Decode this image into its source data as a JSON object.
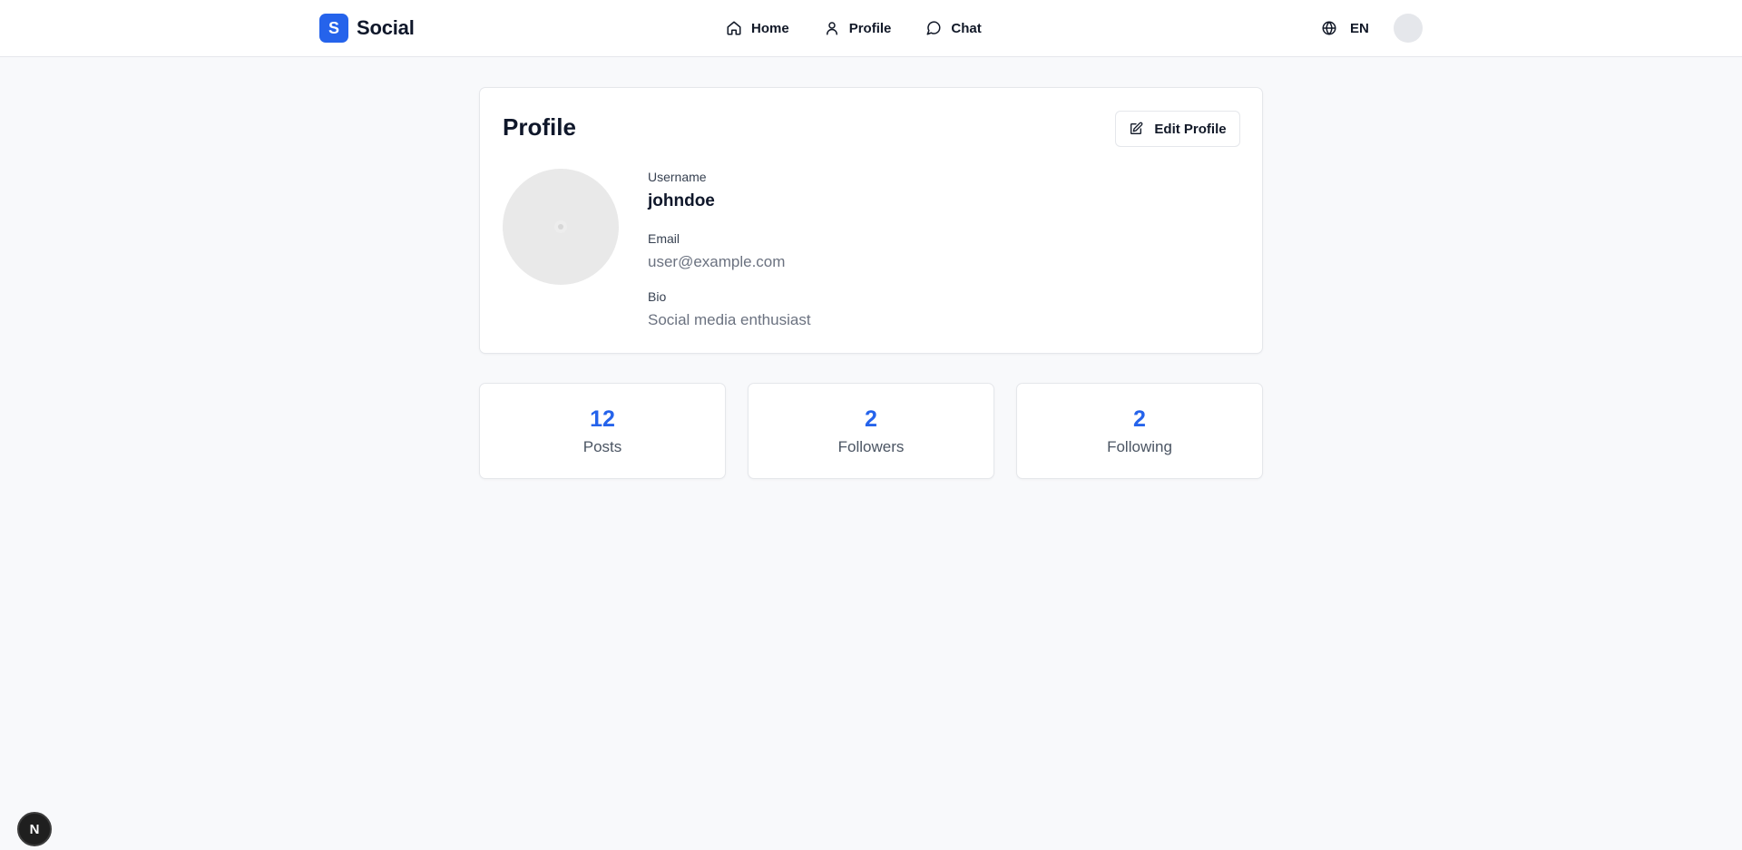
{
  "header": {
    "brand_letter": "S",
    "brand_name": "Social",
    "nav": [
      {
        "label": "Home",
        "icon": "home-icon"
      },
      {
        "label": "Profile",
        "icon": "user-icon"
      },
      {
        "label": "Chat",
        "icon": "message-circle-icon"
      }
    ],
    "language": "EN",
    "accent_color": "#2563eb"
  },
  "profile": {
    "title": "Profile",
    "edit_label": "Edit Profile",
    "username_label": "Username",
    "username": "johndoe",
    "email_label": "Email",
    "email": "user@example.com",
    "bio_label": "Bio",
    "bio": "Social media enthusiast"
  },
  "stats": [
    {
      "value": "12",
      "label": "Posts"
    },
    {
      "value": "2",
      "label": "Followers"
    },
    {
      "value": "2",
      "label": "Following"
    }
  ],
  "dev_badge": "N"
}
